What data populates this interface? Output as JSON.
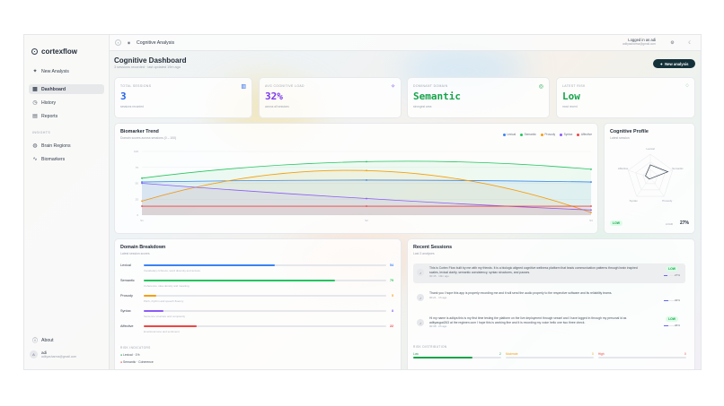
{
  "app": {
    "name": "cortexflow"
  },
  "sidebar": {
    "new_analysis": "New Analysis",
    "items": [
      {
        "label": "Dashboard",
        "icon": "grid-icon",
        "active": true
      },
      {
        "label": "History",
        "icon": "clock-icon"
      },
      {
        "label": "Reports",
        "icon": "document-icon"
      }
    ],
    "section_label": "Insights",
    "insights": [
      {
        "label": "Brain Regions",
        "icon": "globe-icon"
      },
      {
        "label": "Biomarkers",
        "icon": "pulse-icon"
      }
    ],
    "about": "About",
    "user": {
      "name": "adi",
      "email": "adityasharma@gmail.com",
      "initial": "A"
    }
  },
  "topbar": {
    "title": "Cognitive Analysis",
    "logged_in": "Logged in as adi",
    "logged_sub": "adityasharma@gmail.com"
  },
  "dashboard": {
    "title": "Cognitive Dashboard",
    "subtitle": "3 sessions recorded · last updated 19m ago",
    "new_button": "New analysis"
  },
  "stats": [
    {
      "label": "Total Sessions",
      "value": "3",
      "sub": "sessions recorded",
      "color": "#2563eb",
      "icon": "chart-icon"
    },
    {
      "label": "Avg Cognitive Load",
      "value": "32%",
      "sub": "across all sessions",
      "color": "#7c3aed",
      "icon": "sparkle-icon"
    },
    {
      "label": "Dominant Domain",
      "value": "Semantic",
      "sub": "strongest area",
      "color": "#16a34a",
      "icon": "target-icon"
    },
    {
      "label": "Latest Risk",
      "value": "Low",
      "sub": "most recent",
      "color": "#16a34a",
      "icon": "shield-icon"
    }
  ],
  "chart_data": {
    "type": "line",
    "title": "Biomarker Trend",
    "subtitle": "Domain scores across sessions (0 – 100)",
    "x": [
      "S1",
      "S2",
      "S3"
    ],
    "ylim": [
      0,
      100
    ],
    "yticks": [
      "100",
      "75",
      "50",
      "25",
      "0"
    ],
    "series": [
      {
        "name": "Lexical",
        "color": "#3b82f6",
        "values": [
          52,
          55,
          52
        ]
      },
      {
        "name": "Semantic",
        "color": "#22c55e",
        "values": [
          58,
          84,
          72
        ]
      },
      {
        "name": "Prosody",
        "color": "#f59e0b",
        "values": [
          22,
          70,
          4
        ]
      },
      {
        "name": "Syntax",
        "color": "#8b5cf6",
        "values": [
          50,
          26,
          8
        ]
      },
      {
        "name": "Affective",
        "color": "#ef4444",
        "values": [
          14,
          14,
          14
        ]
      }
    ]
  },
  "profile": {
    "title": "Cognitive Profile",
    "subtitle": "Latest session",
    "axes": [
      "Lexical",
      "Semantic",
      "Prosody",
      "Syntax",
      "Affective"
    ],
    "risk": "LOW",
    "load_label": "LOAD",
    "load_value": "27%"
  },
  "domain_breakdown": {
    "title": "Domain Breakdown",
    "subtitle": "Latest session scores",
    "rows": [
      {
        "name": "Lexical",
        "value": 54,
        "color": "#3b82f6",
        "note": "Vocabulary richness, word diversity and access"
      },
      {
        "name": "Semantic",
        "value": 79,
        "color": "#22c55e",
        "note": "Coherence, idea density and meaning"
      },
      {
        "name": "Prosody",
        "value": 5,
        "color": "#f59e0b",
        "note": "Pitch, rhythm and speech fluency"
      },
      {
        "name": "Syntax",
        "value": 8,
        "color": "#8b5cf6",
        "note": "Sentence structure and complexity"
      },
      {
        "name": "Affective",
        "value": 22,
        "color": "#ef4444",
        "note": "Emotional tone and sentiment"
      }
    ],
    "risk_title": "Risk Indicators",
    "risks": [
      {
        "text": "Lexical · 1%",
        "color": "#16a34a"
      },
      {
        "text": "Semantic · Coherence",
        "color": "#ef4444"
      }
    ]
  },
  "sessions": {
    "title": "Recent Sessions",
    "subtitle": "Last 3 analyses",
    "items": [
      {
        "text": "This is Cortex Flow built by me with my friends. It is a biologic aligned cognitive wellness platform that leads communication patterns through brain inspired scales, lexical clarity, semantic consistency, syntax structures, and pauses.",
        "meta": "00:45 · 19m ago",
        "risk": "LOW",
        "pct": "27%",
        "fill": 0.27,
        "highlight": true
      },
      {
        "text": "Thank you I hope this app is properly recording me and it will send the audio properly to the respective software and its reliability teams.",
        "meta": "00:21 · 1h ago",
        "risk": "",
        "pct": "33%",
        "fill": 0.33,
        "highlight": false
      },
      {
        "text": "Hi my name is aditya this is my first time testing the platform on the live deployment through vessel and I have logged in through my personal id as adityasgod263 at the regimen.com I hope this is working fine and it is recording my voice hello one two three check.",
        "meta": "00:38 · 2h ago",
        "risk": "LOW",
        "pct": "36%",
        "fill": 0.36,
        "highlight": false
      }
    ],
    "risk_dist_title": "Risk Distribution",
    "risk_dist": [
      {
        "label": "Low",
        "value": "2",
        "color": "#16a34a",
        "fill": 0.67
      },
      {
        "label": "Moderate",
        "value": "0",
        "color": "#f59e0b",
        "fill": 0
      },
      {
        "label": "High",
        "value": "0",
        "color": "#ef4444",
        "fill": 0
      }
    ]
  }
}
